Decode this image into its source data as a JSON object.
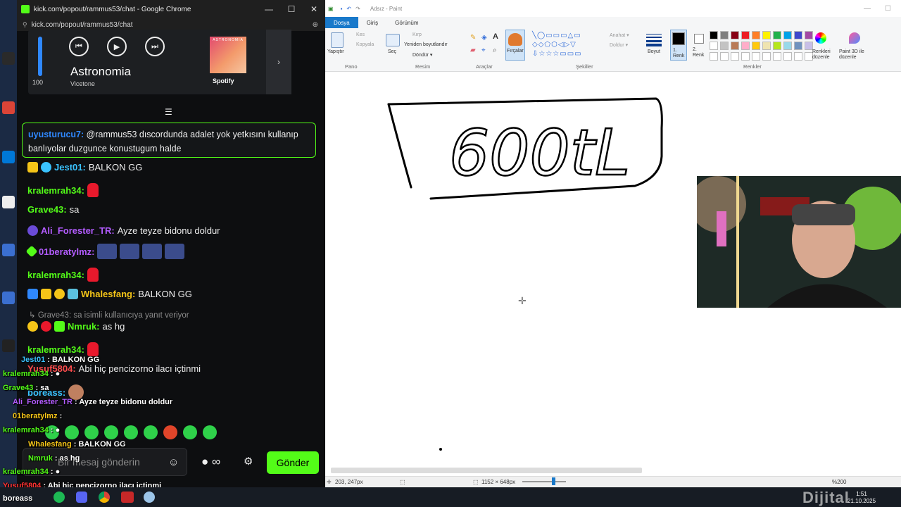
{
  "chrome": {
    "title": "kick.com/popout/rammus53/chat - Google Chrome",
    "url": "kick.com/popout/rammus53/chat",
    "minimize": "—",
    "maximize": "☐",
    "close": "✕"
  },
  "media": {
    "volume": "100",
    "volume_fraction": 1.0,
    "song_title": "Astronomia",
    "artist": "Vicetone",
    "album_text": "ASTRONOMIA",
    "source": "Spotify",
    "prev_icon": "⏮",
    "play_icon": "▶",
    "next_icon": "⏭",
    "expand_icon": "›"
  },
  "chat": {
    "pinned": {
      "user": "uyusturucu7:",
      "text": " @rammus53 dıscordunda adalet yok yetkısını kullanıp banlıyolar duzgunce konustugum halde",
      "user_color": "#2f88ff"
    },
    "messages": [
      {
        "user": "Jest01:",
        "text": "BALKON GG",
        "color": "#3ac3ff"
      },
      {
        "user": "kralemrah34:",
        "text": "",
        "color": "#53fc18",
        "emote": "red"
      },
      {
        "user": "Grave43:",
        "text": "sa",
        "color": "#53fc18"
      },
      {
        "user": "Ali_Forester_TR:",
        "text": "Ayze teyze bidonu doldur",
        "color": "#b35cff"
      },
      {
        "user": "01beratylmz:",
        "text": "",
        "color": "#b35cff",
        "emote": "blue4"
      },
      {
        "user": "kralemrah34:",
        "text": "",
        "color": "#53fc18",
        "emote": "red"
      },
      {
        "user": "Whalesfang:",
        "text": "BALKON GG",
        "color": "#f5c518"
      },
      {
        "user": "Nmruk:",
        "text": "as hg",
        "color": "#53fc18"
      },
      {
        "user": "kralemrah34:",
        "text": "",
        "color": "#53fc18",
        "emote": "red"
      },
      {
        "user": "Yusuf5804:",
        "text": "Abi hiç pencizorno ilacı içtinmi",
        "color": "#ff4d4d"
      },
      {
        "user": "boreass:",
        "text": "",
        "color": "#3ac3ff"
      }
    ],
    "reply_text": "↳ Grave43: sa isimli kullanıcıya yanıt veriyor",
    "input_placeholder": "Bir mesaj gönderin",
    "send_label": "Gönder",
    "smile_icon": "☺",
    "infinity_icon": "● ∞",
    "gear_icon": "⚙"
  },
  "overlay_chat": [
    {
      "user": "Jest01",
      "text": "BALKON GG",
      "color": "#3ac3ff"
    },
    {
      "user": "kralemrah34",
      "text": "",
      "color": "#53fc18"
    },
    {
      "user": "Grave43",
      "text": "sa",
      "color": "#53fc18"
    },
    {
      "user": "Ali_Forester_TR",
      "text": "Ayze teyze bidonu doldur",
      "color": "#b35cff"
    },
    {
      "user": "01beratylmz",
      "text": "",
      "color": "#f5c518"
    },
    {
      "user": "kralemrah34",
      "text": "",
      "color": "#53fc18"
    },
    {
      "user": "Whalesfang",
      "text": "BALKON GG",
      "color": "#f5c518"
    },
    {
      "user": "Nmruk",
      "text": "as hg",
      "color": "#53fc18"
    },
    {
      "user": "kralemrah34",
      "text": "",
      "color": "#53fc18"
    },
    {
      "user": "Yusuf5804",
      "text": "Abi hiç pencizorno ilacı içtinmi",
      "color": "#ff3333"
    },
    {
      "user": "boreass",
      "text": "",
      "color": "#3ac3ff"
    }
  ],
  "paint": {
    "title": "Adsız - Paint",
    "tabs": [
      "Dosya",
      "Giriş",
      "Görünüm"
    ],
    "groups": [
      "Pano",
      "Resim",
      "Araçlar",
      "Şekiller",
      "Renkler"
    ],
    "ribbon": {
      "paste": "Yapıştır",
      "cut": "Kes",
      "copy": "Kopyala",
      "select": "Seç",
      "crop": "Kırp",
      "resize": "Yeniden boyutlandır",
      "rotate": "Döndür ▾",
      "brushes": "Fırçalar",
      "outline": "Anahat ▾",
      "fill": "Doldur ▾",
      "size": "Boyut",
      "color1": "1. Renk",
      "color2": "2. Renk",
      "edit_colors": "Renkleri düzenle",
      "paint3d": "Paint 3D ile düzenle",
      "text_tool": "A"
    },
    "palette": [
      "#000000",
      "#7f7f7f",
      "#880015",
      "#ed1c24",
      "#ff7f27",
      "#fff200",
      "#22b14c",
      "#00a2e8",
      "#3f48cc",
      "#a349a4",
      "#ffffff",
      "#c3c3c3",
      "#b97a57",
      "#ffaec9",
      "#ffc90e",
      "#efe4b0",
      "#b5e61d",
      "#99d9ea",
      "#7092be",
      "#c8bfe7"
    ],
    "drawing_text": "600tL",
    "status": {
      "cursor": "203, 247px",
      "size": "1152 × 648px",
      "zoom": "%200"
    }
  },
  "taskbar": {
    "time": "1:51",
    "date": "21.10.2025",
    "watermark": "Dijital"
  }
}
